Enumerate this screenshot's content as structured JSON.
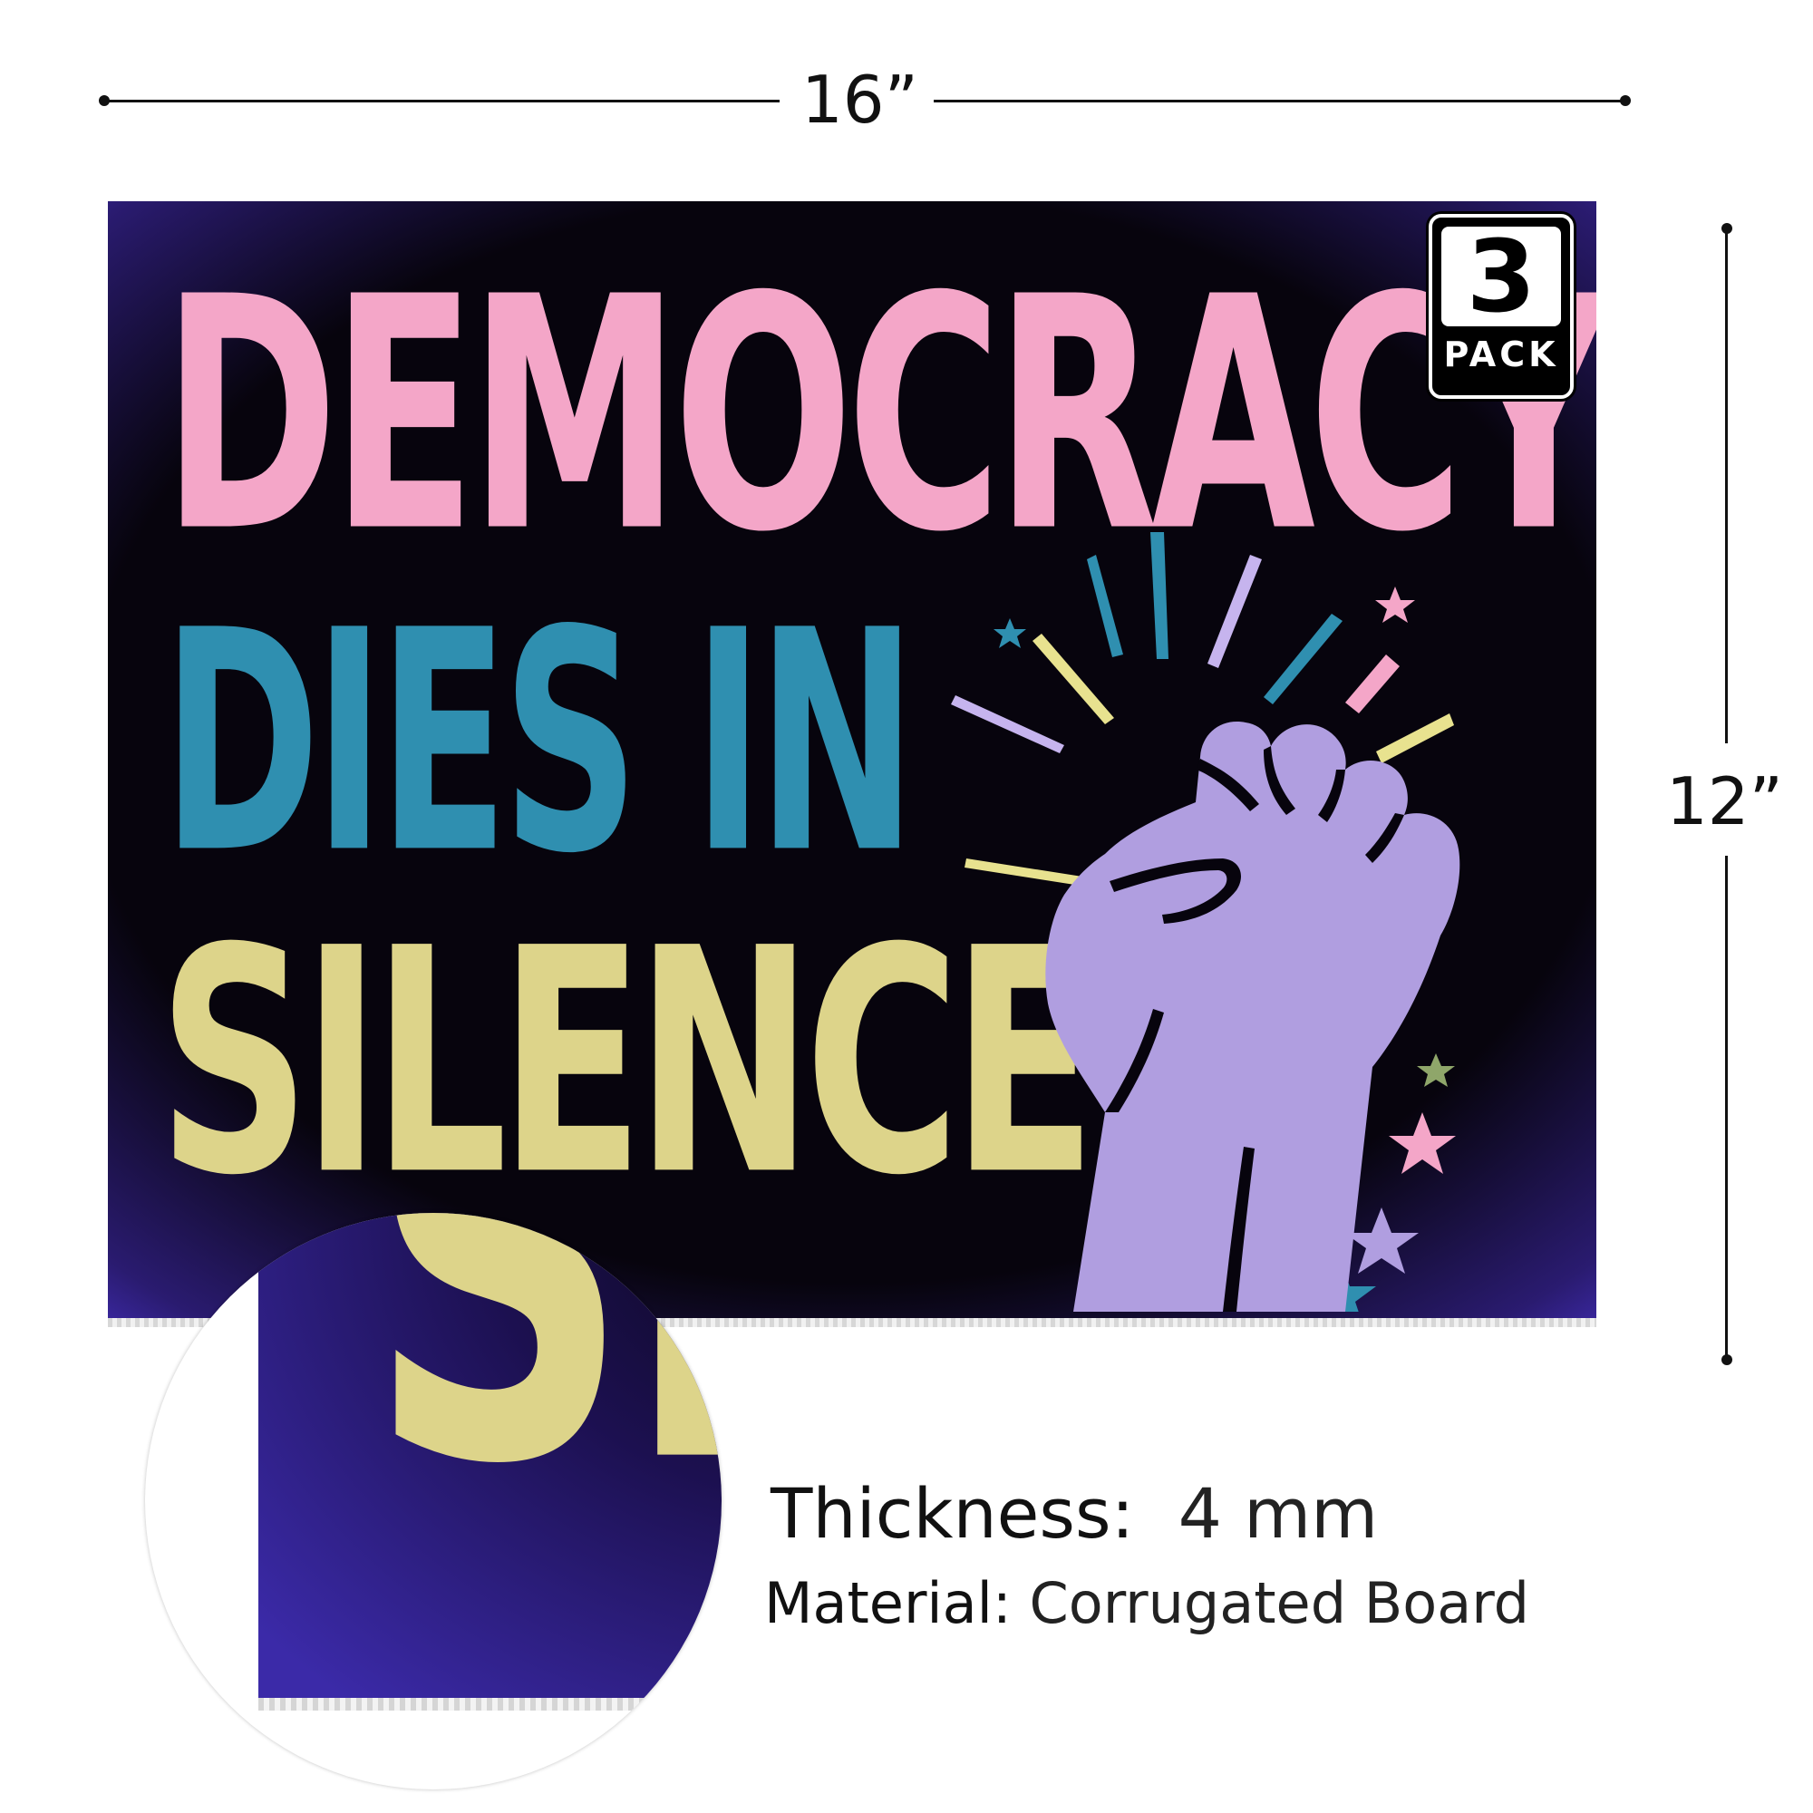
{
  "dimensions": {
    "width_label": "16”",
    "height_label": "12”"
  },
  "sign": {
    "line1": "DEMOCRACY",
    "line2": "DIES IN",
    "line3": "SILENCE",
    "colors": {
      "line1": "#f4a6c8",
      "line2": "#2f8fb0",
      "line3": "#ddd48a",
      "fist": "#b09ee0",
      "background": "#07040d",
      "glow": "#4530c0"
    },
    "fist_icon": "raised-fist-icon"
  },
  "badge": {
    "number": "3",
    "label": "PACK"
  },
  "zoom": {
    "visible_text": "SI"
  },
  "specs": {
    "thickness_label": "Thickness:",
    "thickness_value": "4 mm",
    "material_label": "Material:",
    "material_value": "Corrugated Board"
  }
}
